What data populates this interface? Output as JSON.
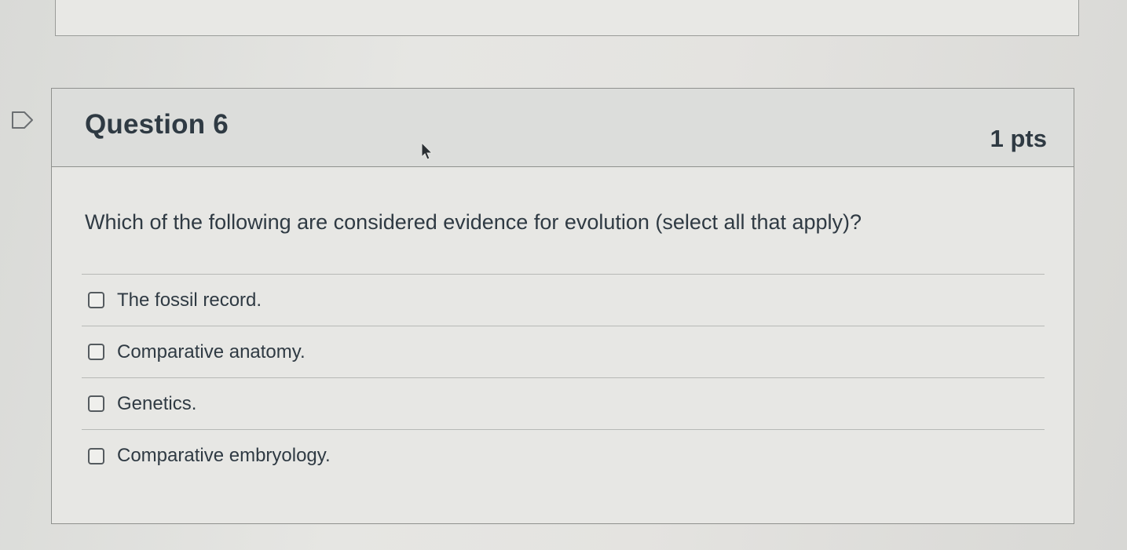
{
  "question": {
    "title": "Question 6",
    "points": "1 pts",
    "text": "Which of the following are considered evidence for evolution (select all that apply)?",
    "answers": [
      {
        "label": "The fossil record.",
        "checked": false
      },
      {
        "label": "Comparative anatomy.",
        "checked": false
      },
      {
        "label": "Genetics.",
        "checked": false
      },
      {
        "label": "Comparative embryology.",
        "checked": false
      }
    ]
  },
  "icons": {
    "flag": "flag-icon",
    "cursor": "mouse-cursor-icon"
  },
  "colors": {
    "text": "#2f3a43",
    "header_bg": "#dcdddb",
    "border": "#8f918e"
  }
}
